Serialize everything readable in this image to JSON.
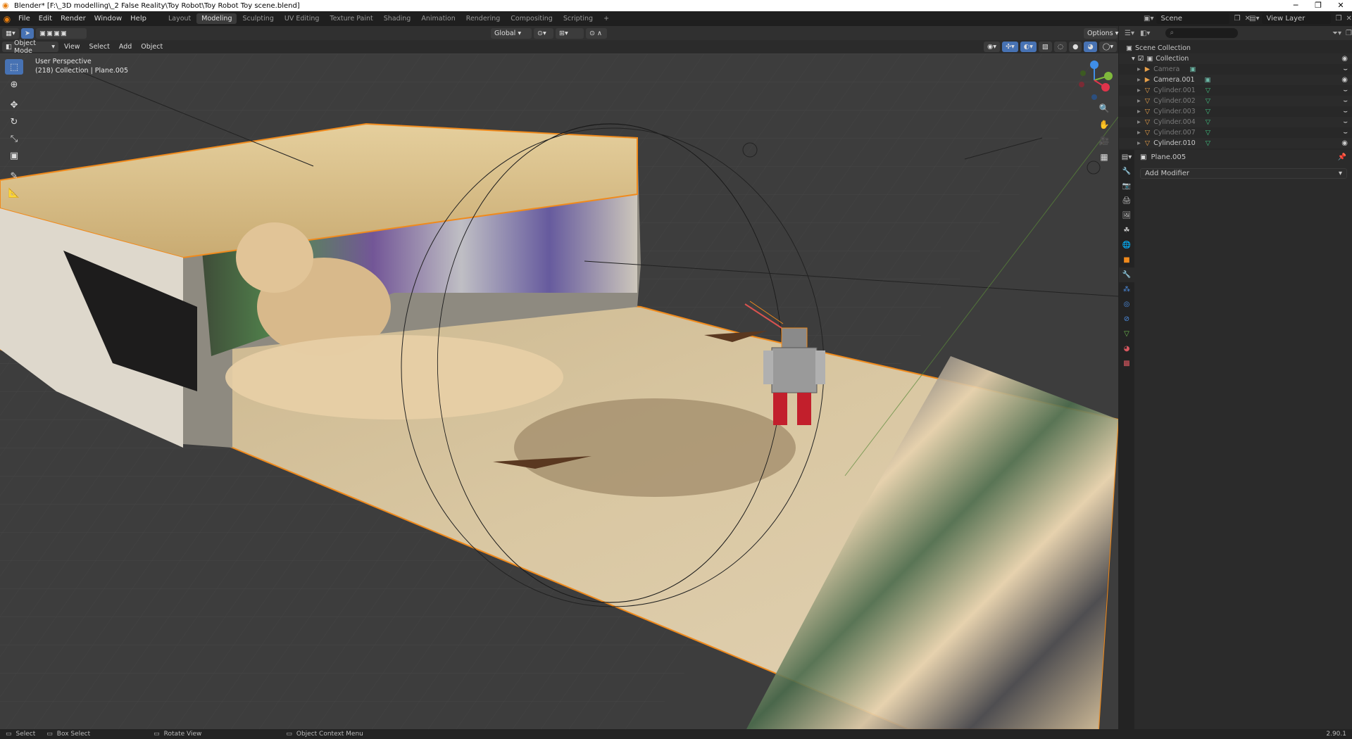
{
  "title": "Blender* [F:\\_3D modelling\\_2 False Reality\\Toy Robot\\Toy Robot Toy scene.blend]",
  "menu": [
    "File",
    "Edit",
    "Render",
    "Window",
    "Help"
  ],
  "workspaces": [
    "Layout",
    "Modeling",
    "Sculpting",
    "UV Editing",
    "Texture Paint",
    "Shading",
    "Animation",
    "Rendering",
    "Compositing",
    "Scripting"
  ],
  "active_workspace": "Modeling",
  "scene_label": "Scene",
  "view_layer_label": "View Layer",
  "header": {
    "orientation": "Global",
    "options": "Options"
  },
  "header2": {
    "mode": "Object Mode",
    "view": "View",
    "select": "Select",
    "add": "Add",
    "object": "Object"
  },
  "viewport": {
    "perspective": "User Perspective",
    "collection_info": "(218) Collection | Plane.005"
  },
  "gizmo": {
    "x": "X",
    "y": "Y",
    "z": "Z"
  },
  "outliner": {
    "root": "Scene Collection",
    "collection": "Collection",
    "items": [
      {
        "name": "Camera",
        "dim": true
      },
      {
        "name": "Camera.001",
        "dim": false
      },
      {
        "name": "Cylinder.001",
        "dim": true
      },
      {
        "name": "Cylinder.002",
        "dim": true
      },
      {
        "name": "Cylinder.003",
        "dim": true
      },
      {
        "name": "Cylinder.004",
        "dim": true
      },
      {
        "name": "Cylinder.007",
        "dim": true
      },
      {
        "name": "Cylinder.010",
        "dim": false
      }
    ]
  },
  "properties": {
    "object": "Plane.005",
    "add_modifier": "Add Modifier"
  },
  "status": {
    "select": "Select",
    "box_select": "Box Select",
    "rotate_view": "Rotate View",
    "context_menu": "Object Context Menu",
    "version": "2.90.1"
  },
  "colors": {
    "accent": "#4772b3",
    "selection": "#f08a1c",
    "gizmo_x": "#e0344b",
    "gizmo_y": "#7fb93c",
    "gizmo_z": "#3f8ee7"
  }
}
